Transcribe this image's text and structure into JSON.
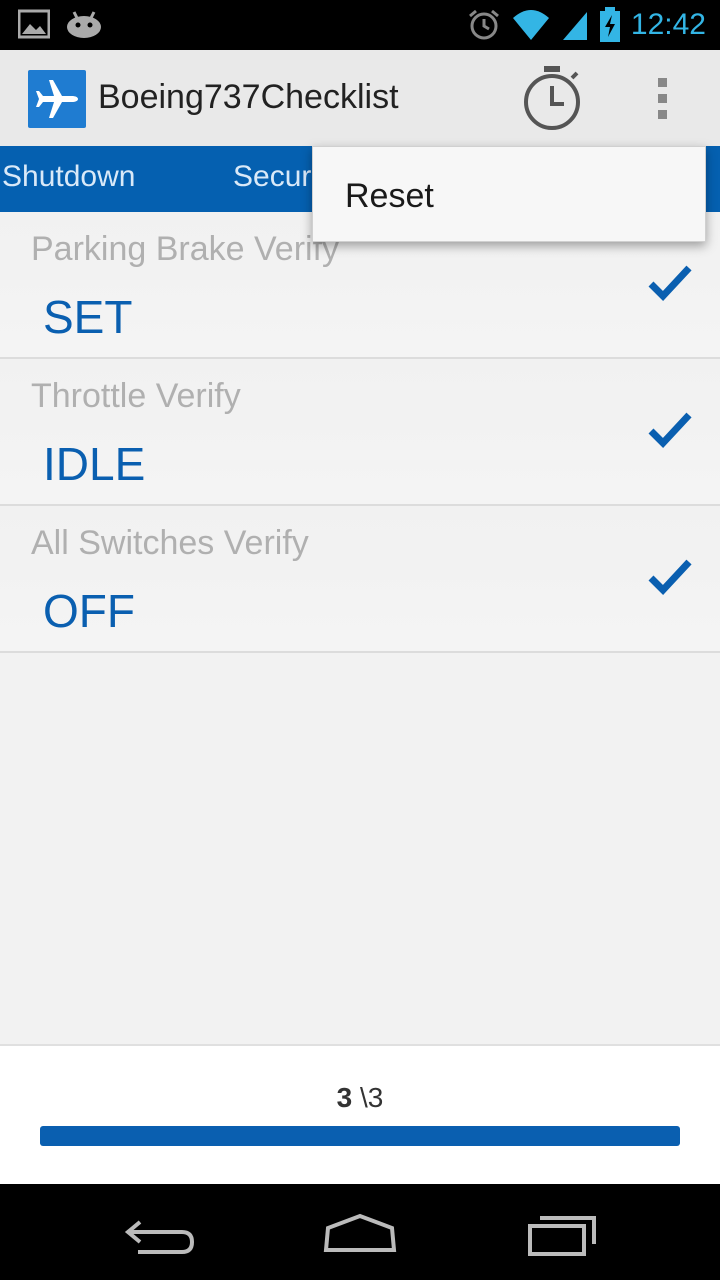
{
  "status_bar": {
    "time": "12:42",
    "icons": [
      "gallery-icon",
      "android-icon",
      "alarm-icon",
      "wifi-icon",
      "signal-icon",
      "battery-charging-icon"
    ]
  },
  "action_bar": {
    "title": "Boeing737Checklist",
    "app_icon": "airplane-icon",
    "actions": [
      "timer-icon",
      "overflow-menu-icon"
    ]
  },
  "tabs": [
    {
      "label": "Shutdown"
    },
    {
      "label": "Secur"
    }
  ],
  "checklist": [
    {
      "label": "Parking Brake Verify",
      "value": "SET",
      "checked": true
    },
    {
      "label": "Throttle Verify",
      "value": "IDLE",
      "checked": true
    },
    {
      "label": "All Switches Verify",
      "value": "OFF",
      "checked": true
    }
  ],
  "progress": {
    "current": "3",
    "separator": " \\3",
    "fraction": 1.0
  },
  "popup_menu": {
    "items": [
      {
        "label": "Reset"
      }
    ]
  },
  "colors": {
    "accent": "#0a5fb0",
    "tab_bar": "#0560b0",
    "clock": "#33b5e5"
  }
}
